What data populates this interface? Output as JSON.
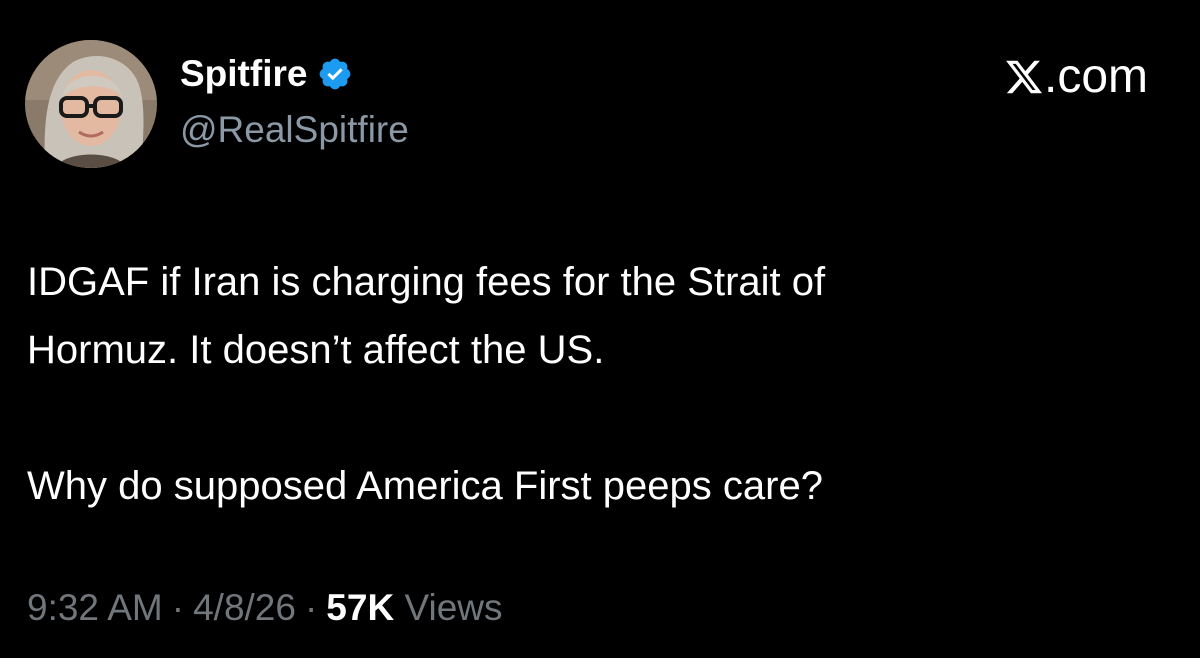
{
  "user": {
    "display_name": "Spitfire",
    "handle": "@RealSpitfire",
    "verified": true
  },
  "brand": {
    "text": ".com",
    "icon": "x-logo-icon"
  },
  "tweet": {
    "paragraph1_line1": "IDGAF if Iran is charging fees for the Strait of",
    "paragraph1_line2": "Hormuz. It doesn’t affect the US.",
    "paragraph2": "Why do supposed America First peeps care?"
  },
  "meta": {
    "time": "9:32 AM",
    "separator": "·",
    "date": "4/8/26",
    "views_count": "57K",
    "views_label": "Views"
  },
  "colors": {
    "background": "#000000",
    "text_primary": "#ffffff",
    "text_secondary": "#71767b",
    "verified_blue": "#1d9bf0"
  }
}
